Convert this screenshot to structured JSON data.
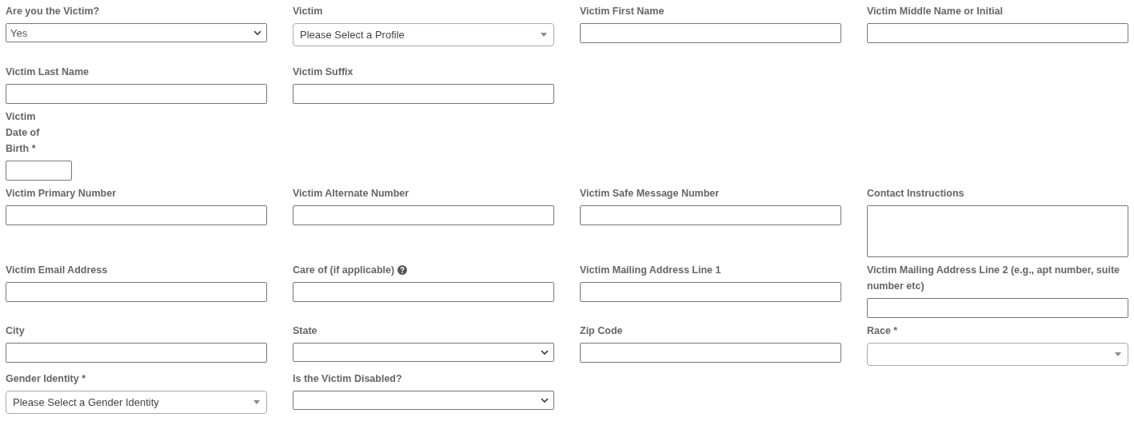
{
  "rows": [
    {
      "fields": [
        {
          "label": "Are you the Victim?",
          "kind": "select",
          "value": "Yes"
        },
        {
          "label": "Victim",
          "kind": "combo",
          "placeholder": "Please Select a Profile"
        },
        {
          "label": "Victim First Name",
          "kind": "text"
        },
        {
          "label": "Victim Middle Name or Initial",
          "kind": "text"
        }
      ]
    },
    {
      "fields": [
        {
          "label": "Victim Last Name",
          "kind": "text"
        },
        {
          "label": "Victim Suffix",
          "kind": "text"
        }
      ]
    },
    {
      "fields": [
        {
          "label": "Victim Date of Birth *",
          "kind": "date"
        }
      ]
    },
    {
      "fields": [
        {
          "label": "Victim Primary Number",
          "kind": "text"
        },
        {
          "label": "Victim Alternate Number",
          "kind": "text"
        },
        {
          "label": "Victim Safe Message Number",
          "kind": "text"
        },
        {
          "label": "Contact Instructions",
          "kind": "textarea"
        }
      ]
    },
    {
      "fields": [
        {
          "label": "Victim Email Address",
          "kind": "text"
        },
        {
          "label": "Care of (if applicable)",
          "kind": "text",
          "help": true
        },
        {
          "label": "Victim Mailing Address Line 1",
          "kind": "text"
        },
        {
          "label": "Victim Mailing Address Line 2 (e.g., apt number, suite number etc)",
          "kind": "text"
        }
      ]
    },
    {
      "fields": [
        {
          "label": "City",
          "kind": "text"
        },
        {
          "label": "State",
          "kind": "select"
        },
        {
          "label": "Zip Code",
          "kind": "text"
        },
        {
          "label": "Race *",
          "kind": "combo"
        }
      ]
    },
    {
      "fields": [
        {
          "label": "Gender Identity *",
          "kind": "combo",
          "placeholder": "Please Select a Gender Identity"
        },
        {
          "label": "Is the Victim Disabled?",
          "kind": "select"
        }
      ]
    }
  ]
}
